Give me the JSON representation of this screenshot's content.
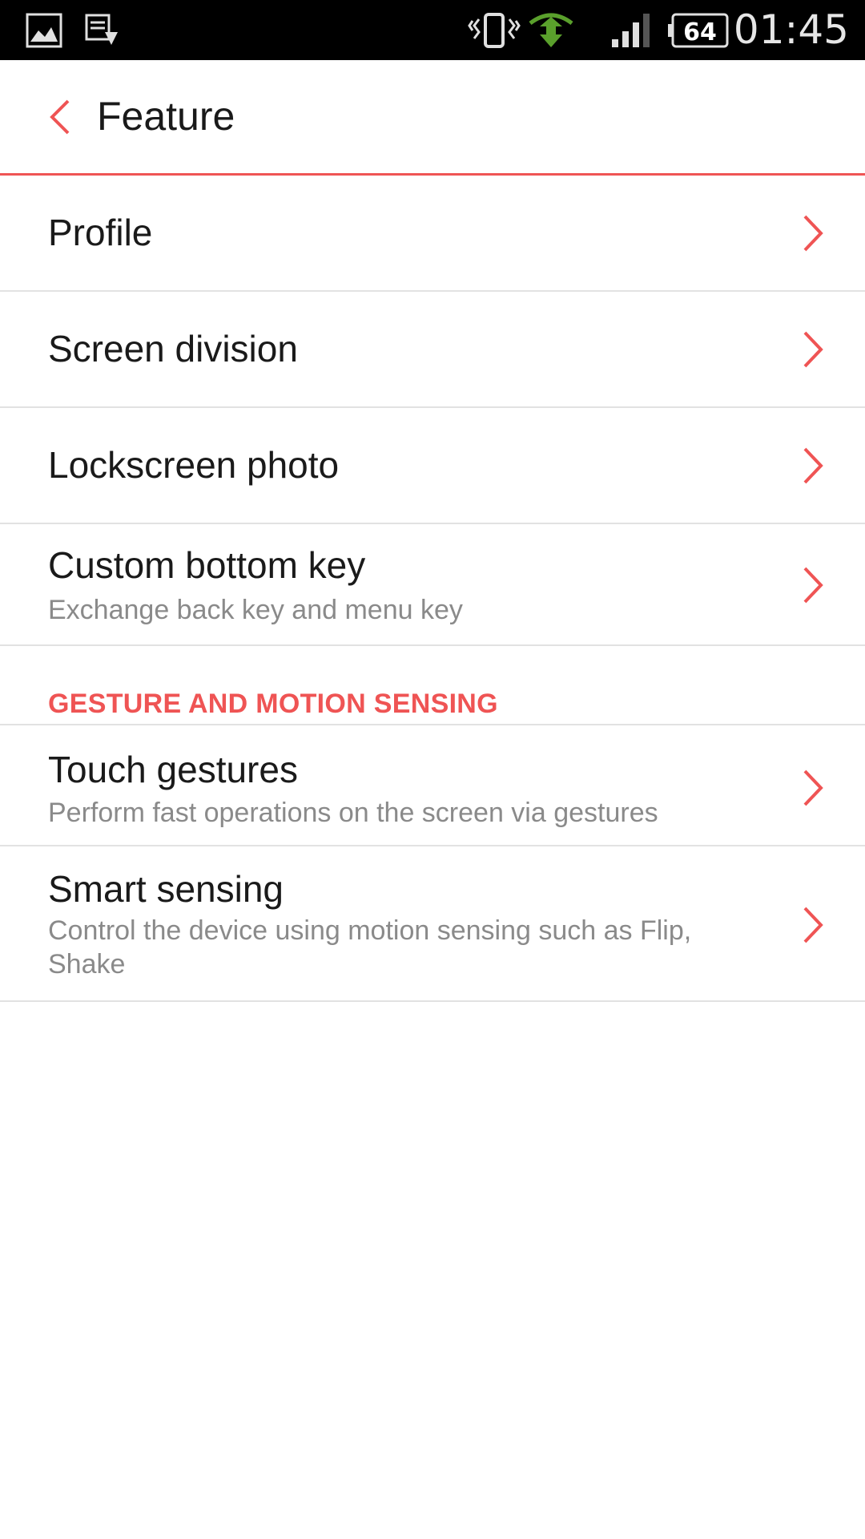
{
  "status_bar": {
    "time": "01:45",
    "battery": "64",
    "icons": [
      "image-icon",
      "download-icon",
      "vibrate-icon",
      "data-transfer-icon",
      "signal-icon",
      "battery-icon"
    ]
  },
  "header": {
    "title": "Feature",
    "back_icon": "chevron-left-icon"
  },
  "items": [
    {
      "title": "Profile",
      "subtitle": ""
    },
    {
      "title": "Screen division",
      "subtitle": ""
    },
    {
      "title": "Lockscreen photo",
      "subtitle": ""
    },
    {
      "title": "Custom bottom key",
      "subtitle": "Exchange back key and menu key"
    }
  ],
  "section": {
    "title": "GESTURE AND MOTION SENSING",
    "items": [
      {
        "title": "Touch gestures",
        "subtitle": "Perform fast operations on the screen via gestures"
      },
      {
        "title": "Smart sensing",
        "subtitle": "Control the device using motion sensing such as Flip, Shake"
      }
    ]
  },
  "colors": {
    "accent": "#ef5454",
    "divider": "#e2e2e2",
    "title_text": "#1a1a1a",
    "subtitle_text": "#8a8a8a",
    "status_bar_bg": "#000000"
  }
}
